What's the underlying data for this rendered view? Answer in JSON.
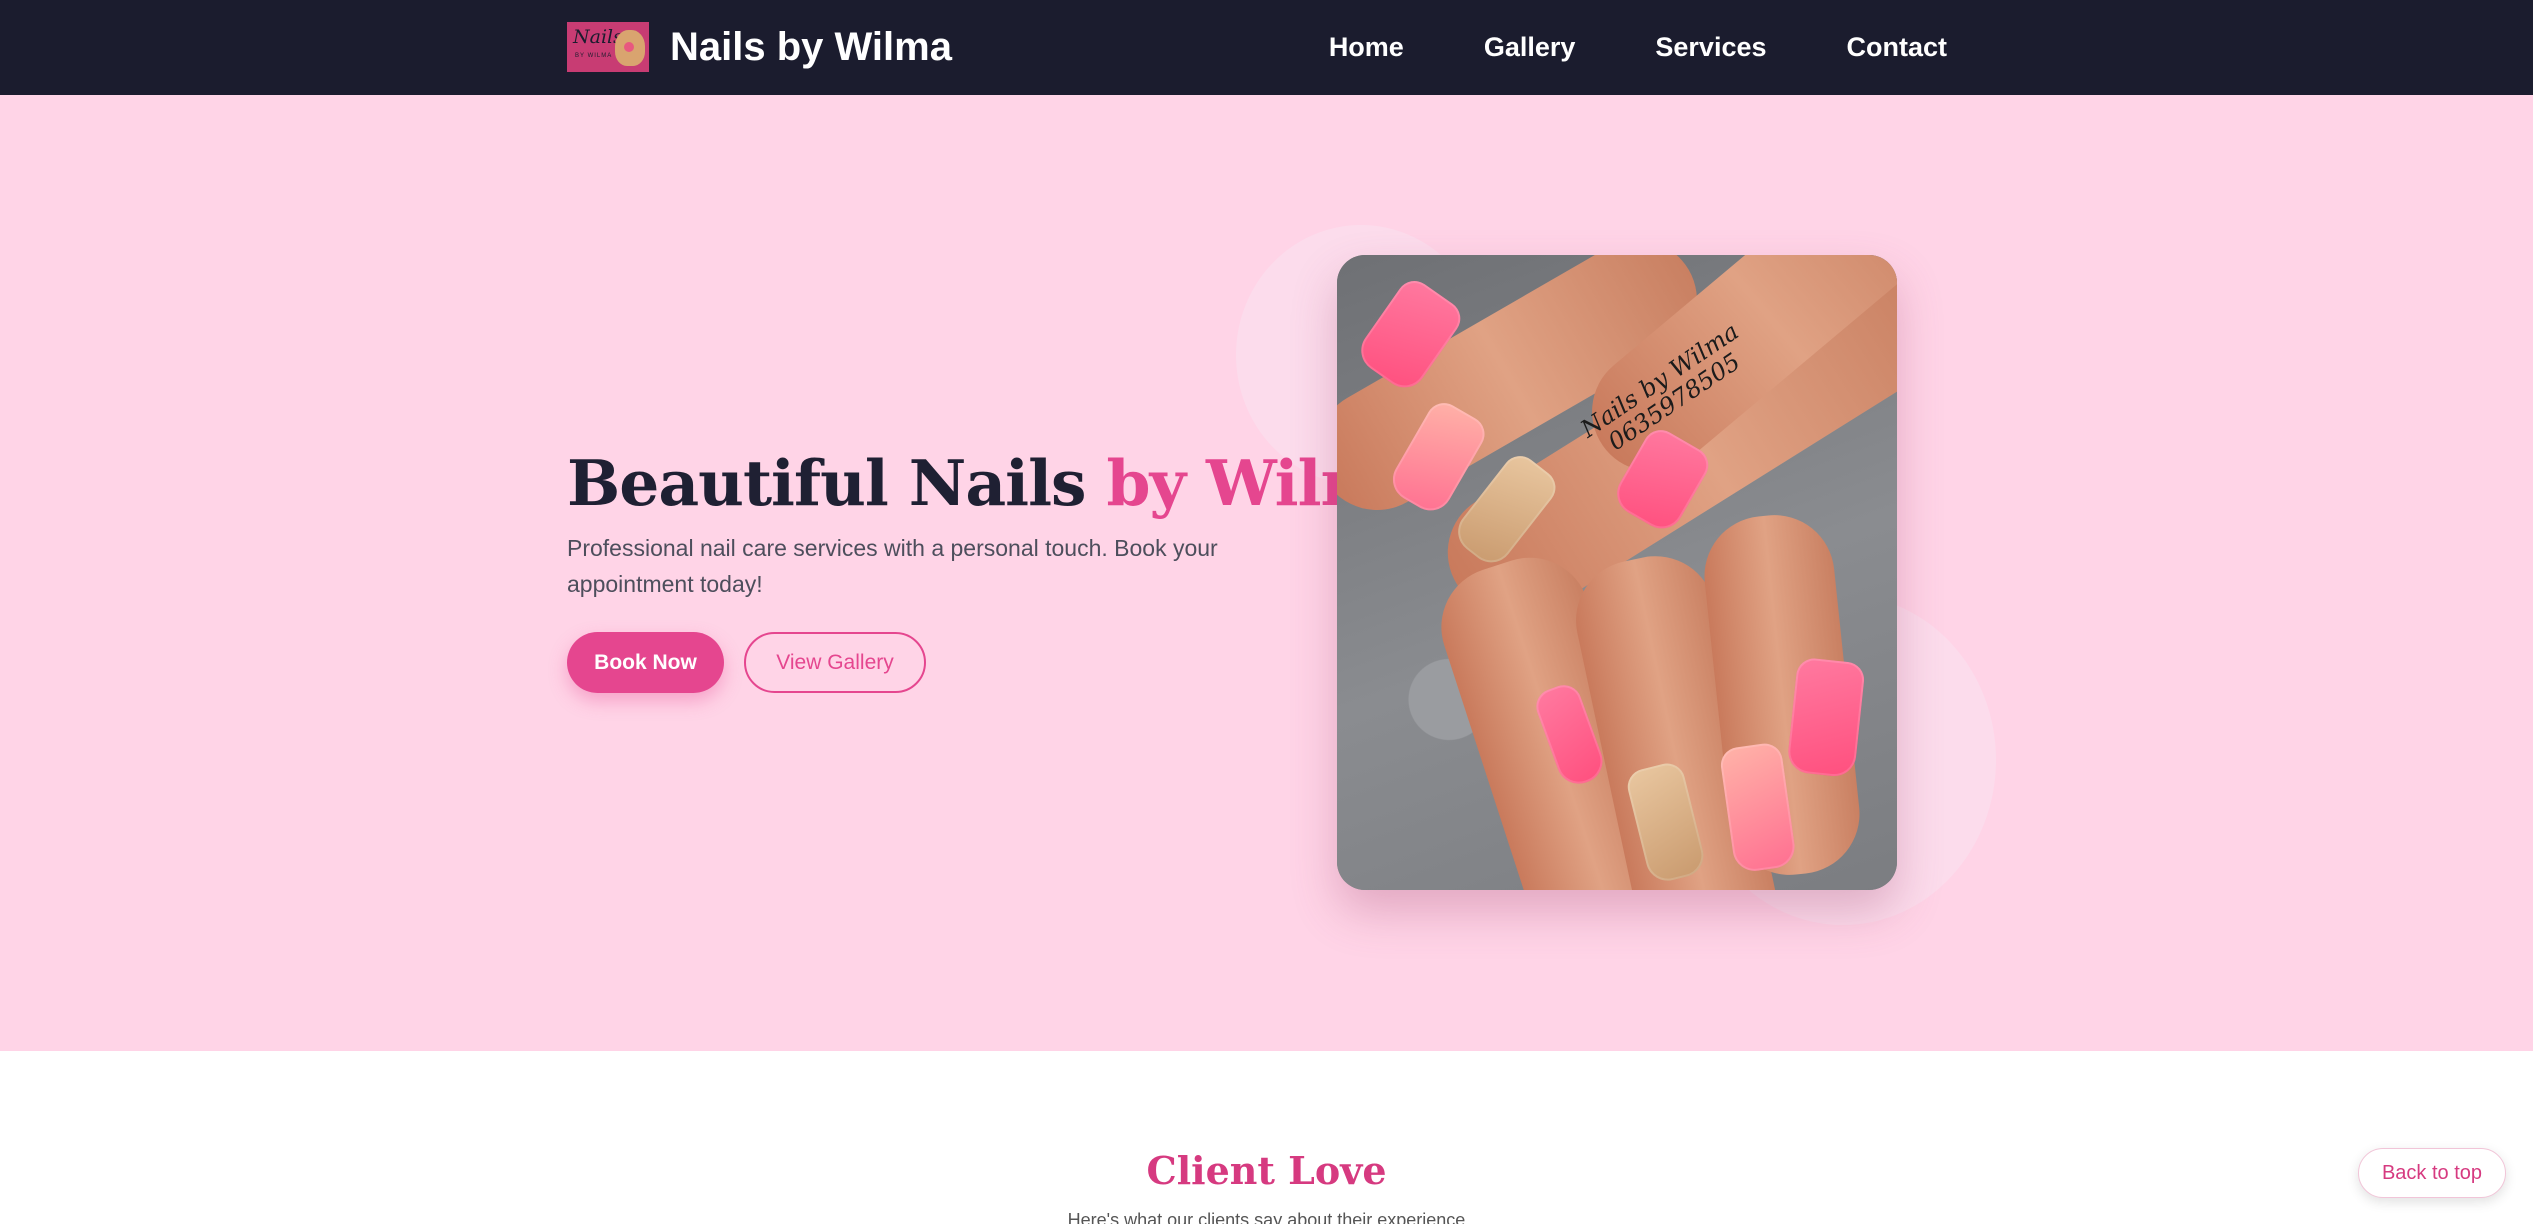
{
  "brand": {
    "logo_script": "Nails",
    "logo_sub": "BY WILMA",
    "name": "Nails by Wilma"
  },
  "nav": {
    "items": [
      {
        "label": "Home"
      },
      {
        "label": "Gallery"
      },
      {
        "label": "Services"
      },
      {
        "label": "Contact"
      }
    ]
  },
  "hero": {
    "title_main": "Beautiful Nails ",
    "title_accent": "by Wilma",
    "subtitle": "Professional nail care services with a personal touch. Book your appointment today!",
    "primary_button": "Book Now",
    "secondary_button": "View Gallery",
    "photo_caption_line1": "Nails by Wilma",
    "photo_caption_line2": "0635978505"
  },
  "client_love": {
    "title": "Client Love",
    "subtitle": "Here's what our clients say about their experience"
  },
  "back_to_top": "Back to top",
  "colors": {
    "navbar_bg": "#1b1c2e",
    "hero_bg": "#ffd4e7",
    "accent": "#e5468f",
    "heading_dark": "#1f2033"
  }
}
